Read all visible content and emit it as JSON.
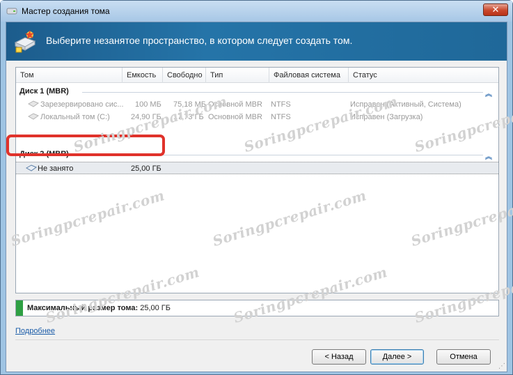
{
  "window": {
    "title": "Мастер создания тома",
    "close_label": "✕"
  },
  "header": {
    "text": "Выберите незанятое пространство, в котором следует создать том."
  },
  "columns": [
    "Том",
    "Емкость",
    "Свободно",
    "Тип",
    "Файловая система",
    "Статус"
  ],
  "groups": [
    {
      "title": "Диск 1 (MBR)",
      "chevron": "︽",
      "rows": [
        {
          "name": "Зарезервировано сис...",
          "capacity": "100 МБ",
          "free": "75,18 МБ",
          "type": "Основной MBR",
          "fs": "NTFS",
          "status": "Исправен (Активный, Система)"
        },
        {
          "name": "Локальный том (C:)",
          "capacity": "24,90 ГБ",
          "free": "17,73 ГБ",
          "type": "Основной MBR",
          "fs": "NTFS",
          "status": "Исправен (Загрузка)"
        }
      ]
    },
    {
      "title": "Диск 2 (MBR)",
      "chevron": "︽",
      "rows": [
        {
          "name": "Не занято",
          "capacity": "25,00 ГБ",
          "free": "",
          "type": "",
          "fs": "",
          "status": ""
        }
      ]
    }
  ],
  "max_size": {
    "label": "Максимальный размер тома:",
    "value": "25,00 ГБ"
  },
  "more_link": "Подробнее",
  "buttons": {
    "back": "< Назад",
    "next": "Далее >",
    "cancel": "Отмена"
  },
  "watermark_text": "Soringpcrepair.com",
  "colors": {
    "header_band": "#1f6899",
    "highlight": "#e0322b",
    "size_fill": "#2ea043",
    "link": "#1a5ca8"
  }
}
